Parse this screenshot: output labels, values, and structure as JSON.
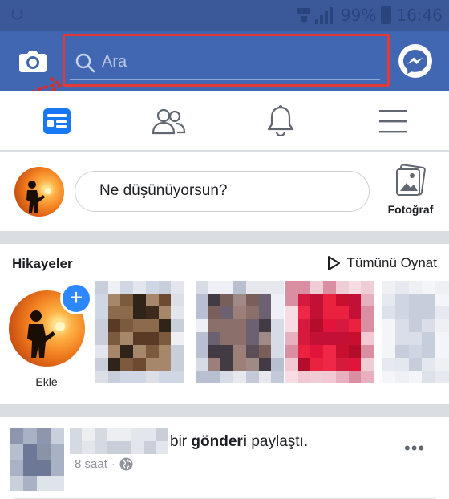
{
  "status_bar": {
    "battery_percent": "99%",
    "time": "16:46",
    "icons": [
      "usb-icon",
      "signal-icon",
      "battery-icon"
    ]
  },
  "top_bar": {
    "search_placeholder": "Ara",
    "icons": [
      "camera-icon",
      "search-icon",
      "messenger-icon"
    ],
    "highlight_color": "#e53935"
  },
  "nav_tabs": [
    {
      "name": "news-feed",
      "icon": "news-feed-icon",
      "active": true
    },
    {
      "name": "friends",
      "icon": "friends-icon",
      "active": false
    },
    {
      "name": "notifications",
      "icon": "bell-icon",
      "active": false
    },
    {
      "name": "menu",
      "icon": "hamburger-icon",
      "active": false
    }
  ],
  "composer": {
    "prompt": "Ne düşünüyorsun?",
    "photo_label": "Fotoğraf"
  },
  "stories": {
    "title": "Hikayeler",
    "play_all": "Tümünü Oynat",
    "add_label": "Ekle",
    "add_symbol": "+"
  },
  "post": {
    "action_prefix": "bir ",
    "action_bold": "gönderi",
    "action_suffix": " paylaştı.",
    "time": "8 saat",
    "separator": "·",
    "more": "•••",
    "privacy_icon": "globe-icon"
  },
  "colors": {
    "brand": "#4267b2",
    "status_bar": "#3b5998",
    "active_tab": "#1877f2",
    "add_badge": "#2d88ff"
  }
}
